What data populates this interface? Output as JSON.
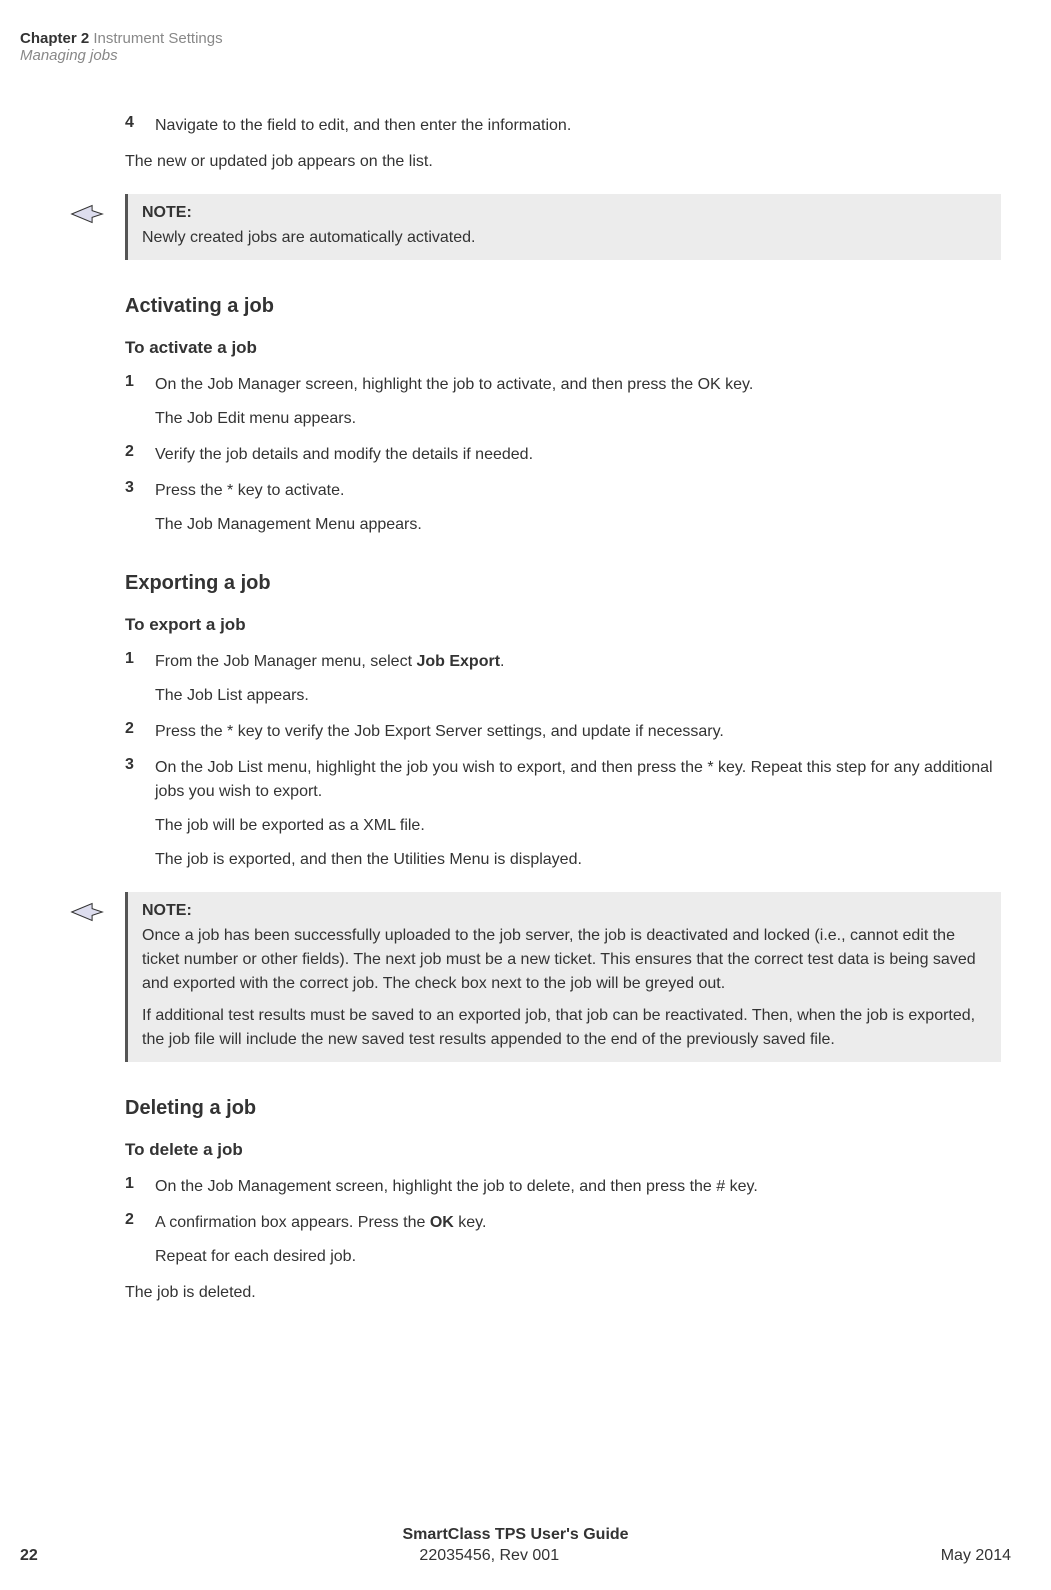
{
  "header": {
    "chapter_bold": "Chapter 2",
    "chapter_light": "Instrument Settings",
    "section_italic": "Managing jobs"
  },
  "intro": {
    "step4_num": "4",
    "step4_text": "Navigate to the field to edit, and then enter the information.",
    "result": "The new or updated job appears on the list."
  },
  "note1": {
    "title": "NOTE:",
    "body": "Newly created jobs are automatically activated."
  },
  "activating": {
    "heading": "Activating a job",
    "subheading": "To activate a job",
    "steps": {
      "n1": "1",
      "t1a": "On the Job Manager screen, highlight the job to activate, and then press the OK key.",
      "t1b": "The Job Edit menu appears.",
      "n2": "2",
      "t2": "Verify the job details and modify the details if needed.",
      "n3": "3",
      "t3a": "Press the * key to activate.",
      "t3b": "The Job Management Menu appears."
    }
  },
  "exporting": {
    "heading": "Exporting a job",
    "subheading": "To export a job",
    "steps": {
      "n1": "1",
      "t1a_pre": "From the Job Manager menu, select ",
      "t1a_bold": "Job Export",
      "t1a_post": ".",
      "t1b": "The Job List appears.",
      "n2": "2",
      "t2": "Press the * key to verify the Job Export Server settings, and update if necessary.",
      "n3": "3",
      "t3a": "On the Job List menu, highlight the job you wish to export, and then press the * key. Repeat this step for any additional jobs you wish to export.",
      "t3b": "The job will be exported as a XML file.",
      "t3c": "The job is exported, and then the Utilities Menu is displayed."
    }
  },
  "note2": {
    "title": "NOTE:",
    "body1": "Once a job has been successfully uploaded to the job server, the job is deactivated and locked (i.e., cannot edit the ticket number or other fields). The next job must be a new ticket. This ensures that the correct test data is being saved and exported with the correct job. The check box next to the job will be greyed out.",
    "body2": "If additional test results must be saved to an exported job, that job can be reactivated. Then, when the job is exported, the job file will include the new saved test results appended to the end of the previously saved file."
  },
  "deleting": {
    "heading": "Deleting a job",
    "subheading": "To delete a job",
    "steps": {
      "n1": "1",
      "t1": "On the Job Management screen, highlight the job to delete, and then press the # key.",
      "n2": "2",
      "t2a_pre": "A confirmation box appears. Press the ",
      "t2a_bold": "OK",
      "t2a_post": " key.",
      "t2b": "Repeat for each desired job."
    },
    "result": "The job is deleted."
  },
  "footer": {
    "title": "SmartClass TPS User's Guide",
    "page": "22",
    "docnum": "22035456, Rev 001",
    "date": "May 2014"
  }
}
